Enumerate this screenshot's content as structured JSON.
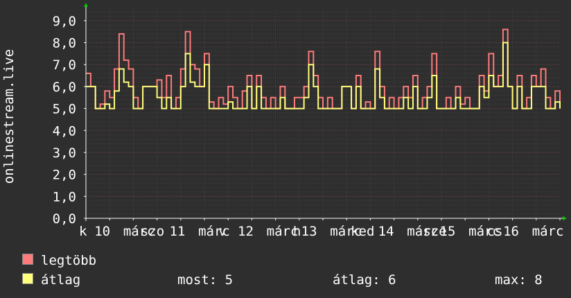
{
  "chart_data": {
    "type": "line",
    "ylabel": "onlinestream.live",
    "ylim": [
      0,
      9.5
    ],
    "xlim": [
      0,
      1
    ],
    "yticks": [
      "0,0",
      "1,0",
      "2,0",
      "3,0",
      "4,0",
      "5,0",
      "6,0",
      "7,0",
      "8,0",
      "9,0"
    ],
    "ytick_values": [
      0,
      1,
      2,
      3,
      4,
      5,
      6,
      7,
      8,
      9
    ],
    "xtick_labels": [
      "k",
      "10",
      "márc",
      "szo",
      "11",
      "márc",
      "v",
      "12",
      "márc",
      "h",
      "13",
      "márc",
      "ked",
      "14",
      "márc",
      "sze",
      "15",
      "márc",
      "cs",
      "16",
      "márc"
    ],
    "xtick_positions": [
      0.0,
      0.032,
      0.092,
      0.128,
      0.188,
      0.248,
      0.29,
      0.33,
      0.39,
      0.445,
      0.462,
      0.522,
      0.565,
      0.622,
      0.682,
      0.715,
      0.75,
      0.81,
      0.848,
      0.882,
      0.942
    ],
    "grid": true,
    "series": [
      {
        "name": "legtöbb",
        "color": "#ff7b7b",
        "x": [
          0,
          0.01,
          0.02,
          0.03,
          0.04,
          0.05,
          0.06,
          0.07,
          0.08,
          0.09,
          0.1,
          0.11,
          0.12,
          0.13,
          0.14,
          0.15,
          0.16,
          0.17,
          0.18,
          0.19,
          0.2,
          0.21,
          0.22,
          0.23,
          0.24,
          0.25,
          0.26,
          0.27,
          0.28,
          0.29,
          0.3,
          0.31,
          0.32,
          0.33,
          0.34,
          0.35,
          0.36,
          0.37,
          0.38,
          0.39,
          0.4,
          0.41,
          0.42,
          0.43,
          0.44,
          0.45,
          0.46,
          0.47,
          0.48,
          0.49,
          0.5,
          0.51,
          0.52,
          0.53,
          0.54,
          0.55,
          0.56,
          0.57,
          0.58,
          0.59,
          0.6,
          0.61,
          0.62,
          0.63,
          0.64,
          0.65,
          0.66,
          0.67,
          0.68,
          0.69,
          0.7,
          0.71,
          0.72,
          0.73,
          0.74,
          0.75,
          0.76,
          0.77,
          0.78,
          0.79,
          0.8,
          0.81,
          0.82,
          0.83,
          0.84,
          0.85,
          0.86,
          0.87,
          0.88,
          0.89,
          0.9,
          0.91,
          0.92,
          0.93,
          0.94,
          0.95,
          0.96,
          0.97,
          0.98,
          0.99,
          1.0
        ],
        "values": [
          6.6,
          6.0,
          5.0,
          5.2,
          5.8,
          5.5,
          6.8,
          8.4,
          7.2,
          6.8,
          5.5,
          5.0,
          6.0,
          6.0,
          6.0,
          6.3,
          5.5,
          6.5,
          5.0,
          5.5,
          6.8,
          8.5,
          7.0,
          6.8,
          6.0,
          7.5,
          5.3,
          5.0,
          5.5,
          5.2,
          6.0,
          5.5,
          5.0,
          5.8,
          6.5,
          5.0,
          6.5,
          5.5,
          5.0,
          5.5,
          5.0,
          6.0,
          5.0,
          5.0,
          5.5,
          5.5,
          6.0,
          7.6,
          6.5,
          5.5,
          5.0,
          5.5,
          5.0,
          5.0,
          6.0,
          6.0,
          5.0,
          6.5,
          5.0,
          5.3,
          5.0,
          7.6,
          6.0,
          5.0,
          5.5,
          5.0,
          5.5,
          6.0,
          5.5,
          6.5,
          5.0,
          5.5,
          6.0,
          7.5,
          5.0,
          5.0,
          5.5,
          5.0,
          6.0,
          5.2,
          5.5,
          5.0,
          5.0,
          6.5,
          5.8,
          7.5,
          6.0,
          6.5,
          8.6,
          6.0,
          5.0,
          6.5,
          5.0,
          5.5,
          6.5,
          6.0,
          6.8,
          5.5,
          5.0,
          5.8,
          5.0
        ]
      },
      {
        "name": "átlag",
        "color": "#ffff7b",
        "x": [
          0,
          0.01,
          0.02,
          0.03,
          0.04,
          0.05,
          0.06,
          0.07,
          0.08,
          0.09,
          0.1,
          0.11,
          0.12,
          0.13,
          0.14,
          0.15,
          0.16,
          0.17,
          0.18,
          0.19,
          0.2,
          0.21,
          0.22,
          0.23,
          0.24,
          0.25,
          0.26,
          0.27,
          0.28,
          0.29,
          0.3,
          0.31,
          0.32,
          0.33,
          0.34,
          0.35,
          0.36,
          0.37,
          0.38,
          0.39,
          0.4,
          0.41,
          0.42,
          0.43,
          0.44,
          0.45,
          0.46,
          0.47,
          0.48,
          0.49,
          0.5,
          0.51,
          0.52,
          0.53,
          0.54,
          0.55,
          0.56,
          0.57,
          0.58,
          0.59,
          0.6,
          0.61,
          0.62,
          0.63,
          0.64,
          0.65,
          0.66,
          0.67,
          0.68,
          0.69,
          0.7,
          0.71,
          0.72,
          0.73,
          0.74,
          0.75,
          0.76,
          0.77,
          0.78,
          0.79,
          0.8,
          0.81,
          0.82,
          0.83,
          0.84,
          0.85,
          0.86,
          0.87,
          0.88,
          0.89,
          0.9,
          0.91,
          0.92,
          0.93,
          0.94,
          0.95,
          0.96,
          0.97,
          0.98,
          0.99,
          1.0
        ],
        "values": [
          6.0,
          6.0,
          5.0,
          5.0,
          5.2,
          5.0,
          5.8,
          6.8,
          6.2,
          6.0,
          5.0,
          5.0,
          6.0,
          6.0,
          6.0,
          5.5,
          5.0,
          5.5,
          5.0,
          5.0,
          6.0,
          7.5,
          6.2,
          6.0,
          6.0,
          7.0,
          5.0,
          5.0,
          5.0,
          5.0,
          5.3,
          5.0,
          5.0,
          5.0,
          6.0,
          5.0,
          6.0,
          5.0,
          5.0,
          5.0,
          5.0,
          5.5,
          5.0,
          5.0,
          5.0,
          5.0,
          5.5,
          7.0,
          6.0,
          5.0,
          5.0,
          5.0,
          5.0,
          5.0,
          6.0,
          6.0,
          5.0,
          6.0,
          5.0,
          5.0,
          5.0,
          6.8,
          5.5,
          5.0,
          5.0,
          5.0,
          5.0,
          5.5,
          5.0,
          6.0,
          5.0,
          5.0,
          5.5,
          6.5,
          5.0,
          5.0,
          5.0,
          5.0,
          5.5,
          5.0,
          5.0,
          5.0,
          5.0,
          6.0,
          5.5,
          6.5,
          6.0,
          6.0,
          8.0,
          6.0,
          5.0,
          6.0,
          5.0,
          5.0,
          6.0,
          6.0,
          6.0,
          5.0,
          5.0,
          5.3,
          5.0
        ]
      }
    ]
  },
  "legend": {
    "items": [
      {
        "label": "legtöbb",
        "color": "#ff7b7b"
      },
      {
        "label": "átlag",
        "color": "#ffff7b"
      }
    ],
    "stats": {
      "most": "most: 5",
      "atlag": "átlag: 6",
      "max": "max: 8"
    }
  },
  "colors": {
    "background": "#2e2e2e",
    "plot_background": "#2e2e2e",
    "grid": "#5a3a3a",
    "axis": "#ffffff",
    "arrow": "#00cc00"
  }
}
